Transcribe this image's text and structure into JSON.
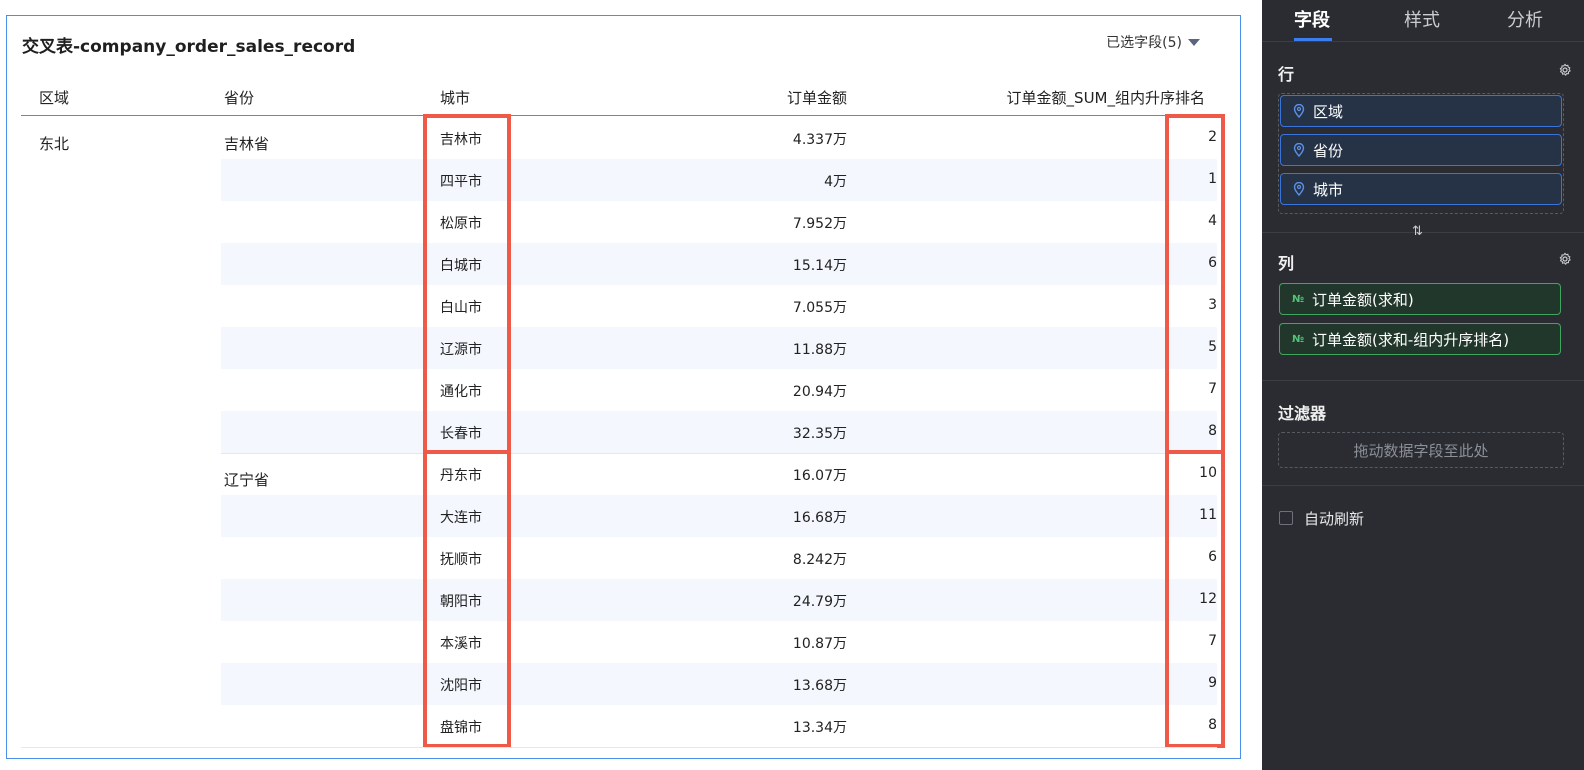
{
  "table": {
    "title": "交叉表-company_order_sales_record",
    "field_selector": "已选字段(5)",
    "headers": {
      "region": "区域",
      "province": "省份",
      "city": "城市",
      "amount": "订单金额",
      "rank": "订单金额_SUM_组内升序排名"
    },
    "region": "东北",
    "groups": [
      {
        "province": "吉林省",
        "rows": [
          {
            "city": "吉林市",
            "amount": "4.337万",
            "rank": "2"
          },
          {
            "city": "四平市",
            "amount": "4万",
            "rank": "1"
          },
          {
            "city": "松原市",
            "amount": "7.952万",
            "rank": "4"
          },
          {
            "city": "白城市",
            "amount": "15.14万",
            "rank": "6"
          },
          {
            "city": "白山市",
            "amount": "7.055万",
            "rank": "3"
          },
          {
            "city": "辽源市",
            "amount": "11.88万",
            "rank": "5"
          },
          {
            "city": "通化市",
            "amount": "20.94万",
            "rank": "7"
          },
          {
            "city": "长春市",
            "amount": "32.35万",
            "rank": "8"
          }
        ]
      },
      {
        "province": "辽宁省",
        "rows": [
          {
            "city": "丹东市",
            "amount": "16.07万",
            "rank": "10"
          },
          {
            "city": "大连市",
            "amount": "16.68万",
            "rank": "11"
          },
          {
            "city": "抚顺市",
            "amount": "8.242万",
            "rank": "6"
          },
          {
            "city": "朝阳市",
            "amount": "24.79万",
            "rank": "12"
          },
          {
            "city": "本溪市",
            "amount": "10.87万",
            "rank": "7"
          },
          {
            "city": "沈阳市",
            "amount": "13.68万",
            "rank": "9"
          },
          {
            "city": "盘锦市",
            "amount": "13.34万",
            "rank": "8"
          }
        ]
      }
    ]
  },
  "panel": {
    "tabs": [
      "字段",
      "样式",
      "分析"
    ],
    "active_tab": "字段",
    "rows_label": "行",
    "row_fields": [
      "区域",
      "省份",
      "城市"
    ],
    "columns_label": "列",
    "column_fields": [
      "订单金额(求和)",
      "订单金额(求和-组内升序排名)"
    ],
    "measure_icon": "№",
    "swap_icon": "⇅",
    "filter_label": "过滤器",
    "filter_hint": "拖动数据字段至此处",
    "auto_refresh_label": "自动刷新",
    "auto_refresh_checked": false
  },
  "colors": {
    "accent_blue": "#4a8fe8",
    "highlight_red": "#ef5a48",
    "panel_bg": "#2a2c31",
    "dimension_border": "#3a73d9",
    "measure_border": "#3fa660"
  }
}
